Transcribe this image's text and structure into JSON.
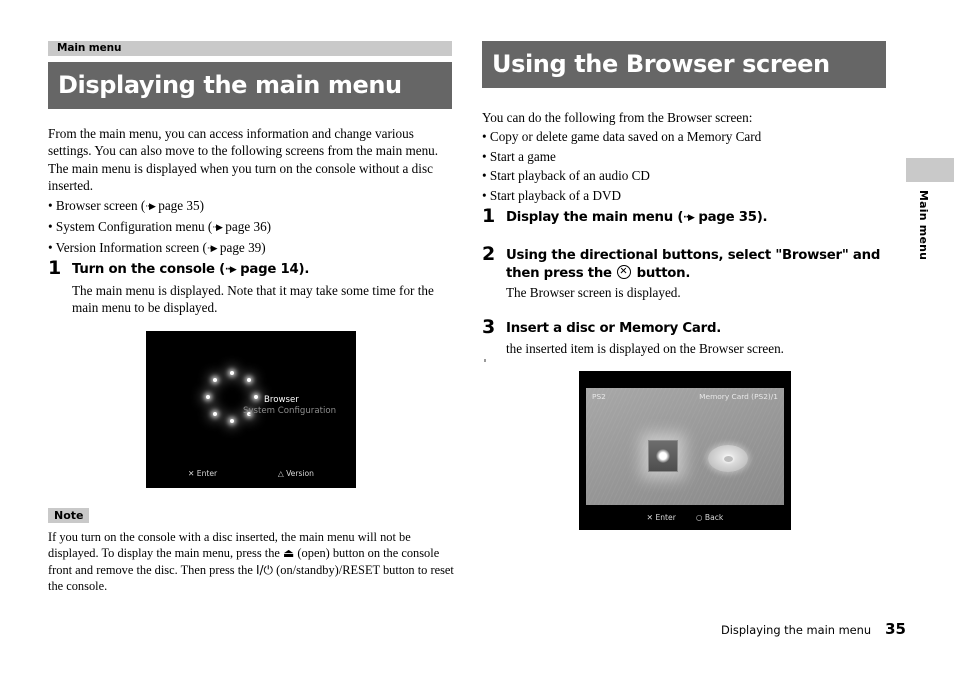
{
  "left": {
    "eyebrow": "Main menu",
    "title": "Displaying the main menu",
    "intro": "From the main menu, you can access information and change various settings. You can also move to the following screens from the main menu. The main menu is displayed when you turn on the console without a disc inserted.",
    "bullets": [
      "• Browser screen (",
      "• System Configuration menu (",
      "• Version Information screen ("
    ],
    "bullet_refs": [
      " page 35)",
      " page 36)",
      " page 39)"
    ],
    "step1": {
      "num": "1",
      "head_before": "Turn on the console (",
      "head_after": " page 14).",
      "body": "The main menu is displayed. Note that it may take some time for the main menu to be displayed."
    },
    "note": {
      "tag": "Note",
      "line1": "If you turn on the console with a disc inserted, the main menu will not be displayed.",
      "line2_a": "To display the main menu, press the ",
      "line2_sym": "⏏",
      "line2_b": " (open) button on the console front and",
      "line3_a": "remove the disc. Then press the ",
      "line3_sym": "I/⏻",
      "line3_b": " (on/standby)/RESET button to reset the console."
    },
    "screenshot": {
      "selected_item": "Browser",
      "dim_item": "System Configuration",
      "hint_enter": "✕ Enter",
      "hint_version": "△ Version"
    }
  },
  "right": {
    "title": "Using the Browser screen",
    "intro": "You can do the following from the Browser screen:",
    "bullets": [
      "• Copy or delete game data saved on a Memory Card",
      "• Start a game",
      "• Start playback of an audio CD",
      "• Start playback of a DVD"
    ],
    "step1": {
      "num": "1",
      "head_before": "Display the main menu (",
      "head_after": " page 35)."
    },
    "step2": {
      "num": "2",
      "head_a": "Using the directional buttons, select \"Browser\" and then press the ",
      "head_b": " button.",
      "body": "The Browser screen is displayed."
    },
    "step3": {
      "num": "3",
      "head": "Insert a disc or Memory Card.",
      "body": "the inserted item is displayed on the Browser screen."
    },
    "screenshot": {
      "label_left": "PS2",
      "label_right": "Memory Card (PS2)/1",
      "hint_enter": "✕ Enter",
      "hint_back": "○ Back"
    }
  },
  "side_tab": {
    "label": "Main menu"
  },
  "footer": {
    "running_head": "Displaying the main menu",
    "page": "35"
  },
  "icons": {
    "xref_arrow": "··▶",
    "eject": "⏏",
    "power": "I/⏻"
  },
  "colors": {
    "eyebrow_bg": "#c9c9c9",
    "title_bg": "#666666",
    "title_text": "#ffffff",
    "page_bg": "#ffffff"
  }
}
